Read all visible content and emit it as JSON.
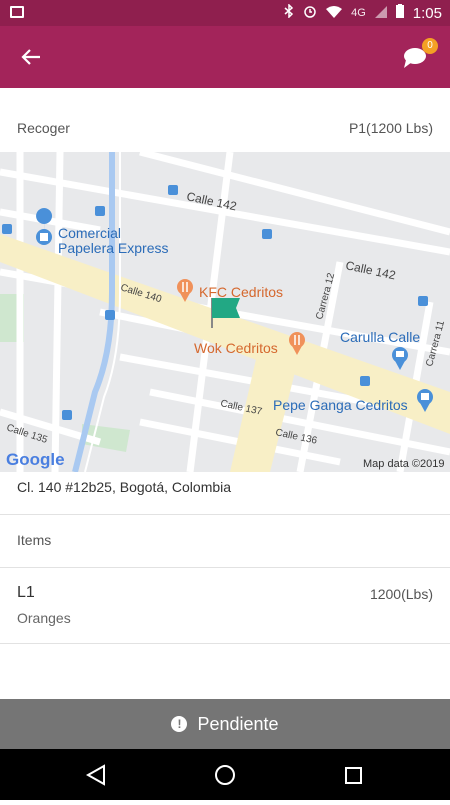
{
  "status_bar": {
    "time": "1:05",
    "network": "4G"
  },
  "app_bar": {
    "chat_badge_count": "0"
  },
  "pickup": {
    "label": "Recoger",
    "value": "P1(1200 Lbs)"
  },
  "map": {
    "labels": {
      "calle142_top": "Calle 142",
      "calle142_right": "Calle 142",
      "comercial_1": "Comercial",
      "comercial_2": "Papelera Express",
      "kfc": "KFC Cedritos",
      "wok": "Wok Cedritos",
      "calle140": "Calle 140",
      "carrera12": "Carrera 12",
      "carrera11": "Carrera 11",
      "carulla": "Carulla Calle",
      "calle137": "Calle 137",
      "pepe_ganga": "Pepe Ganga Cedritos",
      "calle136": "Calle 136",
      "calle135": "Calle 135",
      "google": "Google",
      "map_data": "Map data ©2019"
    },
    "accent_colors": {
      "route": "#a8c8f0",
      "main_road": "#f7eec2",
      "place_pin": "#f0915a",
      "flag": "#22a884"
    }
  },
  "address": "Cl. 140 #12b25, Bogotá, Colombia",
  "items_section": {
    "title": "Items",
    "items": [
      {
        "name": "L1",
        "description": "Oranges",
        "quantity": "1200(Lbs)"
      }
    ]
  },
  "status": {
    "label": "Pendiente"
  },
  "colors": {
    "app_bar": "#a3245a",
    "status_bar": "#8f1f4e",
    "pending_bar": "#757575",
    "badge": "#f4a024"
  }
}
